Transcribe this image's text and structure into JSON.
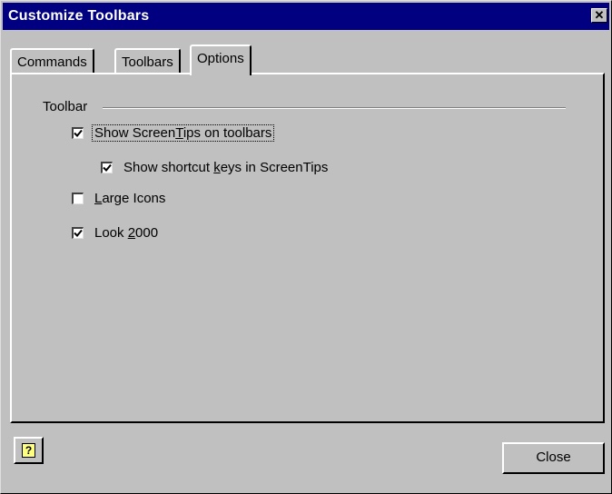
{
  "window": {
    "title": "Customize Toolbars"
  },
  "tabs": [
    {
      "label": "Commands",
      "active": false
    },
    {
      "label": "Toolbars",
      "active": false
    },
    {
      "label": "Options",
      "active": true
    }
  ],
  "toolbar_group": {
    "label": "Toolbar",
    "options": [
      {
        "pre": "Show Screen",
        "accel": "T",
        "post": "ips on toolbars",
        "checked": true,
        "focused": true
      },
      {
        "pre": "Show shortcut ",
        "accel": "k",
        "post": "eys in ScreenTips",
        "checked": true,
        "focused": false
      },
      {
        "pre": "",
        "accel": "L",
        "post": "arge Icons",
        "checked": false,
        "focused": false
      },
      {
        "pre": "Look ",
        "accel": "2",
        "post": "000",
        "checked": true,
        "focused": false
      }
    ]
  },
  "buttons": {
    "close": "Close",
    "help_icon": "?"
  },
  "icons": {
    "help": "help-book-icon",
    "close": "close-icon"
  }
}
